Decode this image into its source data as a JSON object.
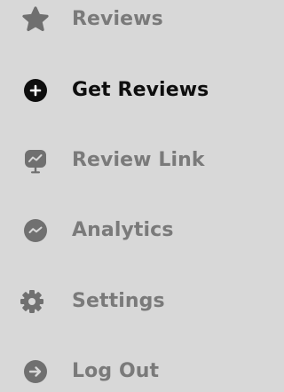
{
  "sidebar": {
    "items": [
      {
        "label": "Reviews",
        "icon": "star-icon",
        "active": false
      },
      {
        "label": "Get Reviews",
        "icon": "plus-circle-icon",
        "active": true
      },
      {
        "label": "Review Link",
        "icon": "monitor-chart-icon",
        "active": false
      },
      {
        "label": "Analytics",
        "icon": "analytics-circle-icon",
        "active": false
      },
      {
        "label": "Settings",
        "icon": "gear-icon",
        "active": false
      },
      {
        "label": "Log Out",
        "icon": "arrow-right-circle-icon",
        "active": false
      }
    ]
  },
  "colors": {
    "background": "#d8d8d8",
    "inactive": "#7a7a7a",
    "active": "#0e0e0e"
  }
}
